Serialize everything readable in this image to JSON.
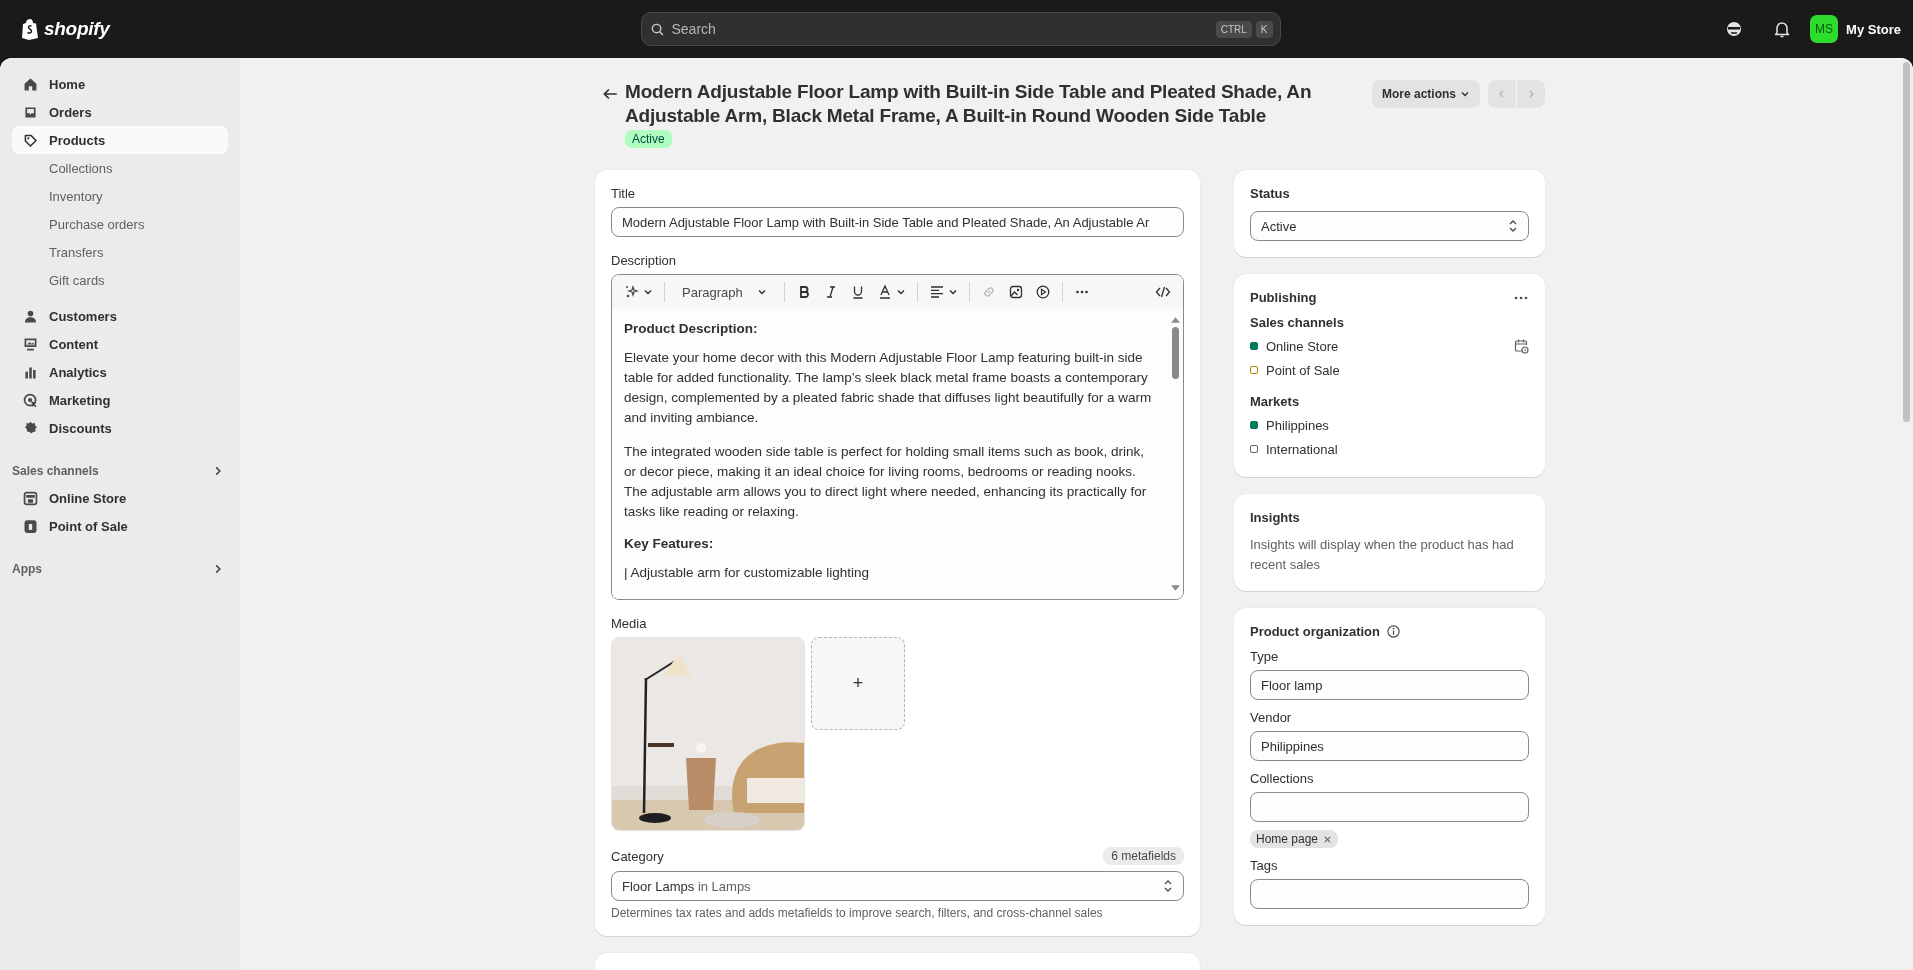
{
  "top_bar": {
    "logo": "shopify",
    "search": {
      "placeholder": "Search",
      "shortcut": [
        "CTRL",
        "K"
      ]
    },
    "store": {
      "initials": "MS",
      "name": "My Store"
    }
  },
  "sidebar": {
    "items": [
      {
        "label": "Home",
        "selected": false
      },
      {
        "label": "Orders",
        "selected": false
      },
      {
        "label": "Products",
        "selected": true,
        "children": [
          {
            "label": "Collections",
            "selected": false
          },
          {
            "label": "Inventory",
            "selected": false
          },
          {
            "label": "Purchase orders",
            "selected": false
          },
          {
            "label": "Transfers",
            "selected": false
          },
          {
            "label": "Gift cards",
            "selected": false
          }
        ]
      },
      {
        "label": "Customers",
        "selected": false
      },
      {
        "label": "Content",
        "selected": false
      },
      {
        "label": "Analytics",
        "selected": false
      },
      {
        "label": "Marketing",
        "selected": false
      },
      {
        "label": "Discounts",
        "selected": false
      }
    ],
    "sections": [
      {
        "title": "Sales channels",
        "items": [
          {
            "label": "Online Store",
            "selected": false
          },
          {
            "label": "Point of Sale",
            "selected": false
          }
        ]
      },
      {
        "title": "Apps"
      }
    ]
  },
  "header": {
    "title": "Modern Adjustable Floor Lamp with Built-in Side Table and Pleated Shade, An Adjustable Arm, Black Metal Frame, A Built-in Round Wooden Side Table",
    "badge": "Active",
    "more_actions": "More actions",
    "pager": {
      "previous_disabled": true,
      "next_disabled": true
    }
  },
  "title_field": {
    "label": "Title",
    "value": "Modern Adjustable Floor Lamp with Built-in Side Table and Pleated Shade, An Adjustable Ar"
  },
  "description": {
    "label": "Description",
    "toolbar": {
      "format": "Paragraph",
      "link_disabled": true
    },
    "blocks": [
      {
        "kind": "heading",
        "text": "Product Description:"
      },
      {
        "kind": "paragraph",
        "text": "Elevate your home decor with this Modern Adjustable Floor Lamp featuring built-in side table for added functionality. The lamp’s sleek black metal frame boasts a contemporary design, complemented by a pleated fabric shade that diffuses light beautifully for a warm and inviting ambiance."
      },
      {
        "kind": "paragraph",
        "text": "The integrated wooden side table is perfect for holding small items such as book, drink, or decor piece, making it an ideal choice for living rooms, bedrooms or reading nooks. The adjustable arm allows you to direct light where needed, enhancing its practically for tasks like reading or relaxing."
      },
      {
        "kind": "heading",
        "text": "Key Features:"
      },
      {
        "kind": "paragraph",
        "text": "| Adjustable arm for customizable lighting"
      }
    ]
  },
  "media": {
    "label": "Media",
    "add": "+"
  },
  "category": {
    "label": "Category",
    "badge": "6 metafields",
    "value": "Floor Lamps",
    "context": "in Lamps",
    "help": "Determines tax rates and adds metafields to improve search, filters, and cross-channel sales"
  },
  "status": {
    "label": "Status",
    "value": "Active"
  },
  "publishing": {
    "title": "Publishing",
    "groups": [
      {
        "title": "Sales channels",
        "items": [
          {
            "name": "Online Store",
            "color": "#047b5d",
            "filled": true
          },
          {
            "name": "Point of Sale",
            "color": "#b28400",
            "filled": false
          }
        ]
      },
      {
        "title": "Markets",
        "items": [
          {
            "name": "Philippines",
            "color": "#047b5d",
            "filled": true
          },
          {
            "name": "International",
            "color": "#616161",
            "filled": false
          }
        ]
      }
    ]
  },
  "insights": {
    "title": "Insights",
    "text": "Insights will display when the product has had recent sales"
  },
  "organization": {
    "title": "Product organization",
    "fields": [
      {
        "label": "Type",
        "value": "Floor lamp"
      },
      {
        "label": "Vendor",
        "value": "Philippines"
      },
      {
        "label": "Collections",
        "tags": [
          "Home page"
        ]
      },
      {
        "label": "Tags"
      }
    ]
  }
}
